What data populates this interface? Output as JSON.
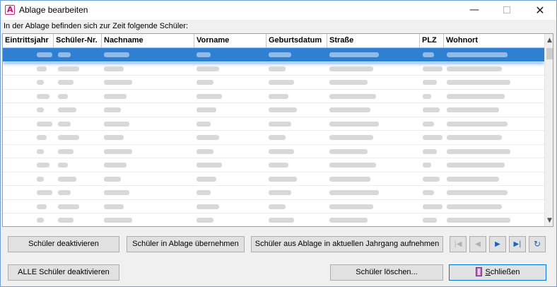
{
  "window": {
    "title": "Ablage bearbeiten",
    "min_glyph": "—",
    "close_glyph": "✕"
  },
  "hint": "In der Ablage befinden sich zur Zeit folgende Schüler:",
  "grid": {
    "columns": [
      "Eintrittsjahr",
      "Schüler-Nr.",
      "Nachname",
      "Vorname",
      "Geburtsdatum",
      "Straße",
      "PLZ",
      "Wohnort"
    ],
    "row_count": 13,
    "selected_row": 0,
    "rows_content_note": "",
    "colors": {
      "selection": "#2f7fd3"
    }
  },
  "scrollbar": {
    "up_glyph": "▲",
    "down_glyph": "▼"
  },
  "buttons": {
    "deactivate": "Schüler deaktivieren",
    "to_archive": "Schüler in Ablage übernehmen",
    "take_into_year": "Schüler aus Ablage in aktuellen Jahrgang aufnehmen",
    "deactivate_all": "ALLE Schüler deaktivieren",
    "delete": "Schüler löschen...",
    "close_prefix": "S",
    "close_rest": "chließen"
  },
  "nav": {
    "first": "|◀",
    "prev": "◀",
    "next": "▶",
    "last": "▶|",
    "refresh": "↻"
  }
}
